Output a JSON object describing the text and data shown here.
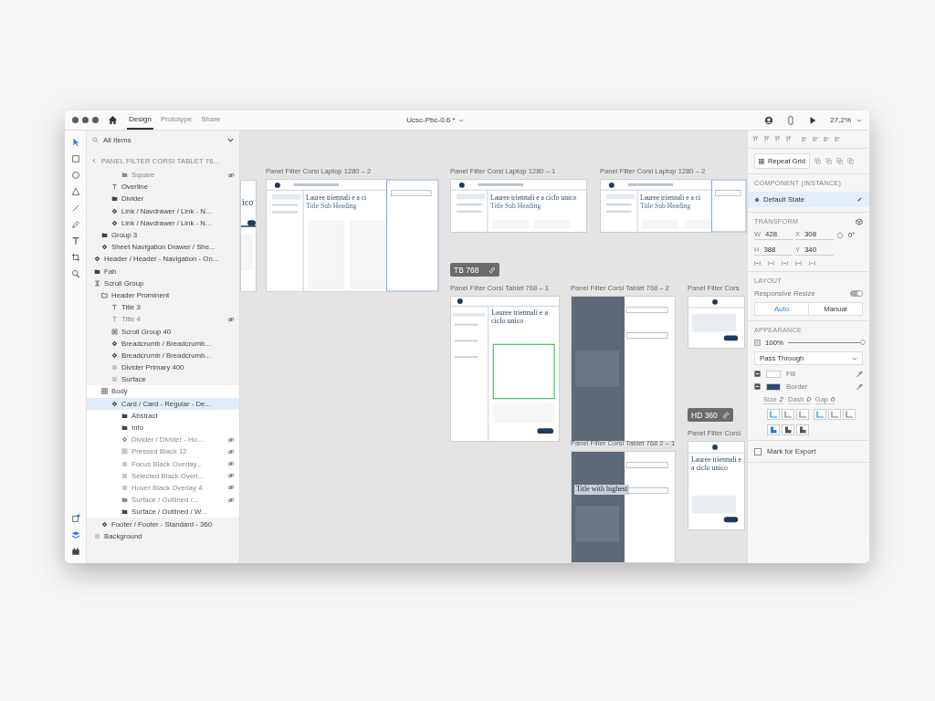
{
  "window": {
    "file_name": "Ucsc-Pbc-0.6 *",
    "zoom": "27,2%"
  },
  "tabs": [
    {
      "label": "Design",
      "selected": true
    },
    {
      "label": "Prototype",
      "selected": false
    },
    {
      "label": "Share",
      "selected": false
    }
  ],
  "layers": {
    "filter": "All Items",
    "back_title": "PANEL FILTER CORSI TABLET 76...",
    "items": [
      {
        "children": [
          {
            "children": [
              {
                "children": [
                  {
                    "name": "Square",
                    "kind": "folder",
                    "hidden": true,
                    "selected": false
                  }
                ]
              },
              {
                "name": "Overline",
                "kind": "text",
                "hidden": false,
                "selected": false
              },
              {
                "name": "Divider",
                "kind": "folder",
                "hidden": false,
                "selected": false
              },
              {
                "name": "Link / Navdrawer / Link - N...",
                "kind": "component",
                "hidden": false,
                "selected": false
              },
              {
                "name": "Link / Navdrawer / Link - N...",
                "kind": "component",
                "hidden": false,
                "selected": false
              }
            ]
          },
          {
            "name": "Group 3",
            "kind": "folder",
            "hidden": false,
            "selected": false
          },
          {
            "name": "Sheet Navigation Drawer / She...",
            "kind": "component",
            "hidden": false,
            "selected": false
          }
        ]
      },
      {
        "name": "Header / Header - Navigation - On...",
        "kind": "component",
        "hidden": false,
        "selected": false
      },
      {
        "name": "Fab",
        "kind": "folder",
        "hidden": false,
        "selected": false
      },
      {
        "name": "Scroll Group",
        "kind": "scroll",
        "hidden": false,
        "selected": false,
        "children": [
          {
            "name": "Header Prominent",
            "kind": "folder-open",
            "hidden": false,
            "selected": false,
            "children": [
              {
                "name": "Title 3",
                "kind": "text",
                "hidden": false,
                "selected": false
              },
              {
                "name": "Title 4",
                "kind": "text",
                "hidden": true,
                "selected": false
              },
              {
                "name": "Scroll Group 40",
                "kind": "image",
                "hidden": false,
                "selected": false
              },
              {
                "name": "Breadcrumb / Breadcrumb...",
                "kind": "component",
                "hidden": false,
                "selected": false
              },
              {
                "name": "Breadcrumb / Breadcrumb...",
                "kind": "component",
                "hidden": false,
                "selected": false
              },
              {
                "name": "Divider Primary 400",
                "kind": "rect",
                "hidden": false,
                "selected": false
              },
              {
                "name": "Surface",
                "kind": "rect",
                "hidden": false,
                "selected": false
              }
            ]
          },
          {
            "name": "Body",
            "kind": "grid",
            "hidden": false,
            "selected": false,
            "focused": true,
            "children": [
              {
                "name": "Card / Card - Regular - De...",
                "kind": "component",
                "hidden": false,
                "selected": true,
                "children": [
                  {
                    "name": "Abstract",
                    "kind": "folder",
                    "hidden": false,
                    "selected": false
                  },
                  {
                    "name": "Info",
                    "kind": "folder",
                    "hidden": false,
                    "selected": false
                  },
                  {
                    "name": "Divider / Divider - Ho...",
                    "kind": "component",
                    "hidden": true,
                    "selected": false
                  },
                  {
                    "name": "Pressed Black 12",
                    "kind": "image",
                    "hidden": true,
                    "selected": false
                  },
                  {
                    "name": "Focus Black Overlay...",
                    "kind": "rect",
                    "hidden": true,
                    "selected": false
                  },
                  {
                    "name": "Selected Black Overl...",
                    "kind": "rect",
                    "hidden": true,
                    "selected": false
                  },
                  {
                    "name": "Hover Black Overlay 4",
                    "kind": "rect",
                    "hidden": true,
                    "selected": false
                  },
                  {
                    "name": "Surface / Outlined /...",
                    "kind": "folder",
                    "hidden": true,
                    "selected": false
                  },
                  {
                    "name": "Surface / Outlined / W...",
                    "kind": "folder",
                    "hidden": false,
                    "selected": false
                  }
                ]
              }
            ]
          },
          {
            "name": "Footer / Footer - Standard - 360",
            "kind": "component",
            "hidden": false,
            "selected": false
          }
        ]
      },
      {
        "name": "Background",
        "kind": "rect",
        "hidden": false,
        "selected": false
      }
    ]
  },
  "artboards": [
    {
      "kind": "laptop-cut",
      "heading": "ico"
    },
    {
      "label": "Panel Filter Corsi Laptop 1280 – 2",
      "kind": "laptop-filter",
      "heading": "Lauree triennali e a ci",
      "subheading": "Title Sub Heading"
    },
    {
      "label": "Panel Filter Corsi Laptop 1280 – 1",
      "kind": "laptop",
      "heading": "Lauree triennali e a ciclo unico",
      "subheading": "Title Sub Heading"
    },
    {
      "label": "Panel Filter Corsi Laptop 1280 – 2",
      "kind": "laptop-filter",
      "heading": "Lauree triennali e a ci",
      "subheading": "Title Sub Heading"
    },
    {
      "label": "Panel Filter Corsi Tablet 768 – 1",
      "kind": "tablet",
      "heading": "Lauree triennali e a ciclo unico"
    },
    {
      "label": "Panel Filter Corsi Tablet 768 – 2",
      "kind": "tablet-dark"
    },
    {
      "label": "Panel Filter Corsi Tablet 768 2 – 1",
      "kind": "tablet-dark",
      "heading": "Title with highest"
    },
    {
      "label": "Panel Filter Cors",
      "kind": "mobile"
    },
    {
      "label": "Panel Filter Corsi",
      "kind": "mobile",
      "heading": "Lauree triennali e a ciclo unico"
    }
  ],
  "badges": [
    {
      "label": "TB 768"
    },
    {
      "label": "HD 360"
    }
  ],
  "inspector": {
    "repeat_grid": "Repeat Grid",
    "component_heading": "COMPONENT (INSTANCE)",
    "state": "Default State",
    "transform_heading": "TRANSFORM",
    "fields": [
      {
        "label": "W",
        "value": "428"
      },
      {
        "label": "X",
        "value": "308"
      },
      {
        "label": "H",
        "value": "388"
      },
      {
        "label": "Y",
        "value": "340"
      }
    ],
    "rotation": "0°",
    "layout_heading": "LAYOUT",
    "responsive_resize": {
      "label": "Responsive Resize",
      "on": true
    },
    "resize_modes": [
      {
        "label": "Auto",
        "selected": true
      },
      {
        "label": "Manual",
        "selected": false
      }
    ],
    "appearance_heading": "APPEARANCE",
    "opacity": {
      "reading": "100%",
      "level": 1
    },
    "blend_mode": "Pass Through",
    "paints": [
      {
        "label": "Fill",
        "color": "#ffffff"
      },
      {
        "label": "Border",
        "color": "#2b4c70"
      }
    ],
    "border_settings": [
      {
        "label": "Size",
        "value": "2"
      },
      {
        "label": "Dash",
        "value": "0"
      },
      {
        "label": "Gap",
        "value": "0"
      }
    ],
    "export": {
      "label": "Mark for Export",
      "checked": false
    }
  }
}
